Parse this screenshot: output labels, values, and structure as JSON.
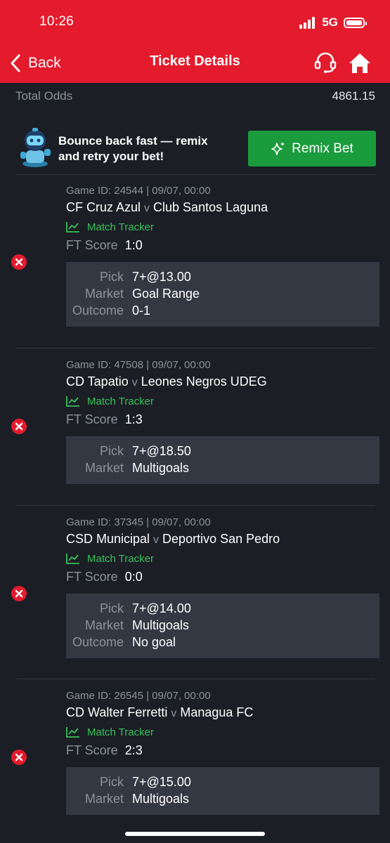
{
  "status_bar": {
    "time": "10:26",
    "network": "5G"
  },
  "nav": {
    "back_label": "Back",
    "title": "Ticket Details"
  },
  "summary": {
    "total_odds_label": "Total Odds",
    "total_odds_value": "4861.15"
  },
  "promo": {
    "line1": "Bounce back fast — remix",
    "line2": "and retry your bet!",
    "button_label": "Remix Bet"
  },
  "labels": {
    "vs": "v",
    "match_tracker": "Match Tracker",
    "ft_score": "FT Score",
    "pick": "Pick",
    "market": "Market",
    "outcome": "Outcome"
  },
  "bets": [
    {
      "game_id": "Game ID: 24544 | 09/07, 00:00",
      "home": "CF Cruz Azul",
      "away": "Club Santos Laguna",
      "ft_score": "1:0",
      "pick": "7+@13.00",
      "market": "Goal Range",
      "outcome": "0-1",
      "status": "lost"
    },
    {
      "game_id": "Game ID: 47508 | 09/07, 00:00",
      "home": "CD Tapatio",
      "away": "Leones Negros UDEG",
      "ft_score": "1:3",
      "pick": "7+@18.50",
      "market": "Multigoals",
      "status": "lost"
    },
    {
      "game_id": "Game ID: 37345 | 09/07, 00:00",
      "home": "CSD Municipal",
      "away": "Deportivo San Pedro",
      "ft_score": "0:0",
      "pick": "7+@14.00",
      "market": "Multigoals",
      "outcome": "No goal",
      "status": "lost"
    },
    {
      "game_id": "Game ID: 26545 | 09/07, 00:00",
      "home": "CD Walter Ferretti",
      "away": "Managua FC",
      "ft_score": "2:3",
      "pick": "7+@15.00",
      "market": "Multigoals",
      "status": "lost"
    }
  ],
  "colors": {
    "header": "#e31b2d",
    "background": "#1b1e25",
    "panel": "#343843",
    "accent_green": "#1a9b3c",
    "tracker_green": "#37c15a",
    "lost_red": "#e31b2d"
  },
  "icons": [
    "back-chevron-icon",
    "headset-icon",
    "home-icon",
    "sparkle-icon",
    "robot-avatar-icon",
    "trend-chart-icon",
    "lost-x-icon"
  ]
}
